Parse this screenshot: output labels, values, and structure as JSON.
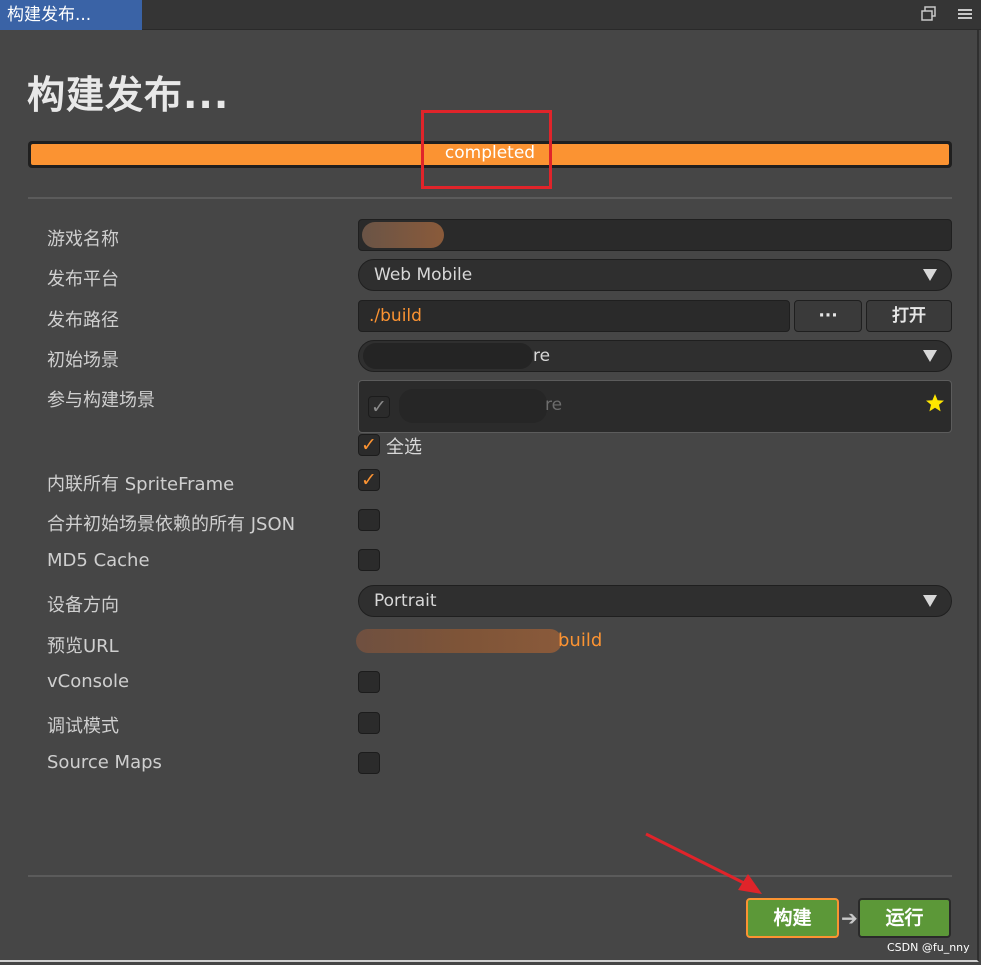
{
  "window": {
    "tab_title": "构建发布..."
  },
  "header": {
    "title": "构建发布..."
  },
  "progress": {
    "value": 1.0,
    "status_text": "completed",
    "fill_color": "#fb9332"
  },
  "form": {
    "game_name_label": "游戏名称",
    "platform_label": "发布平台",
    "platform_value": "Web Mobile",
    "path_label": "发布路径",
    "path_value": "./build",
    "browse_label": "···",
    "open_label": "打开",
    "start_scene_label": "初始场景",
    "start_scene_partial": "re",
    "scenes_label": "参与构建场景",
    "scene_item_partial": "re",
    "select_all_label": "全选",
    "inline_spriteframe_label": "内联所有 SpriteFrame",
    "merge_json_label": "合并初始场景依赖的所有 JSON",
    "md5_label": "MD5 Cache",
    "orientation_label": "设备方向",
    "orientation_value": "Portrait",
    "preview_url_label": "预览URL",
    "preview_url_partial": "build",
    "vconsole_label": "vConsole",
    "debug_label": "调试模式",
    "sourcemaps_label": "Source Maps"
  },
  "checkboxes": {
    "scene_item": true,
    "select_all": true,
    "inline_spriteframe": true,
    "merge_json": false,
    "md5_cache": false,
    "vconsole": false,
    "debug": false,
    "sourcemaps": false
  },
  "footer": {
    "build_label": "构建",
    "run_label": "运行"
  },
  "watermark": "CSDN @fu_nny",
  "colors": {
    "accent": "#fb9332",
    "button_green": "#5c9838",
    "annotation_red": "#e0242a",
    "star": "#ffe600"
  },
  "icons": {
    "restore": "restore-window-icon",
    "menu": "hamburger-menu-icon",
    "star": "star-icon",
    "arrow": "arrow-right-icon"
  }
}
